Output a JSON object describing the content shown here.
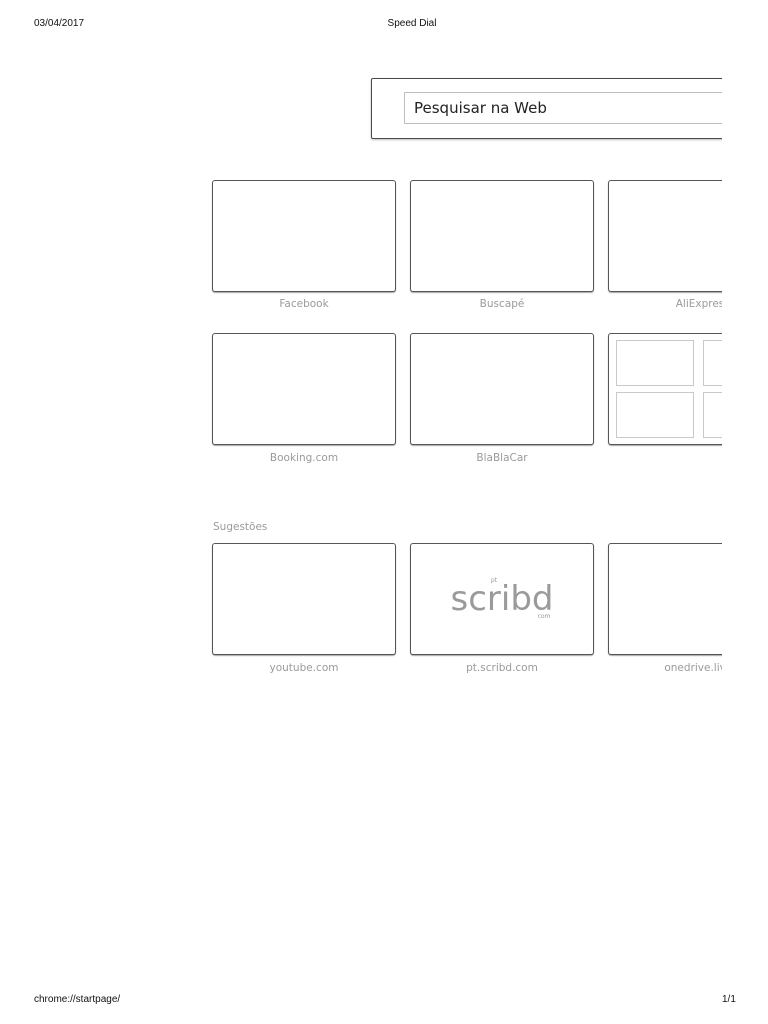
{
  "print_header": {
    "date": "03/04/2017",
    "title": "Speed Dial"
  },
  "print_footer": {
    "url": "chrome://startpage/",
    "page": "1/1"
  },
  "search": {
    "placeholder": "Pesquisar na Web"
  },
  "speed_dial": [
    {
      "label": "Facebook"
    },
    {
      "label": "Buscapé"
    },
    {
      "label": "AliExpres"
    },
    {
      "label": "Booking.com"
    },
    {
      "label": "BlaBlaCar"
    },
    {
      "label": ""
    }
  ],
  "suggestions": {
    "title": "Sugestões",
    "items": [
      {
        "label": "youtube.com"
      },
      {
        "label": "pt.scribd.com",
        "logo": {
          "wordmark": "scribd",
          "prefix": "pt",
          "suffix": "com"
        }
      },
      {
        "label": "onedrive.live."
      }
    ]
  },
  "colors": {
    "tile_border": "#555555",
    "label_gray": "#9a9a9a",
    "logo_gray": "#9a9a9a"
  }
}
